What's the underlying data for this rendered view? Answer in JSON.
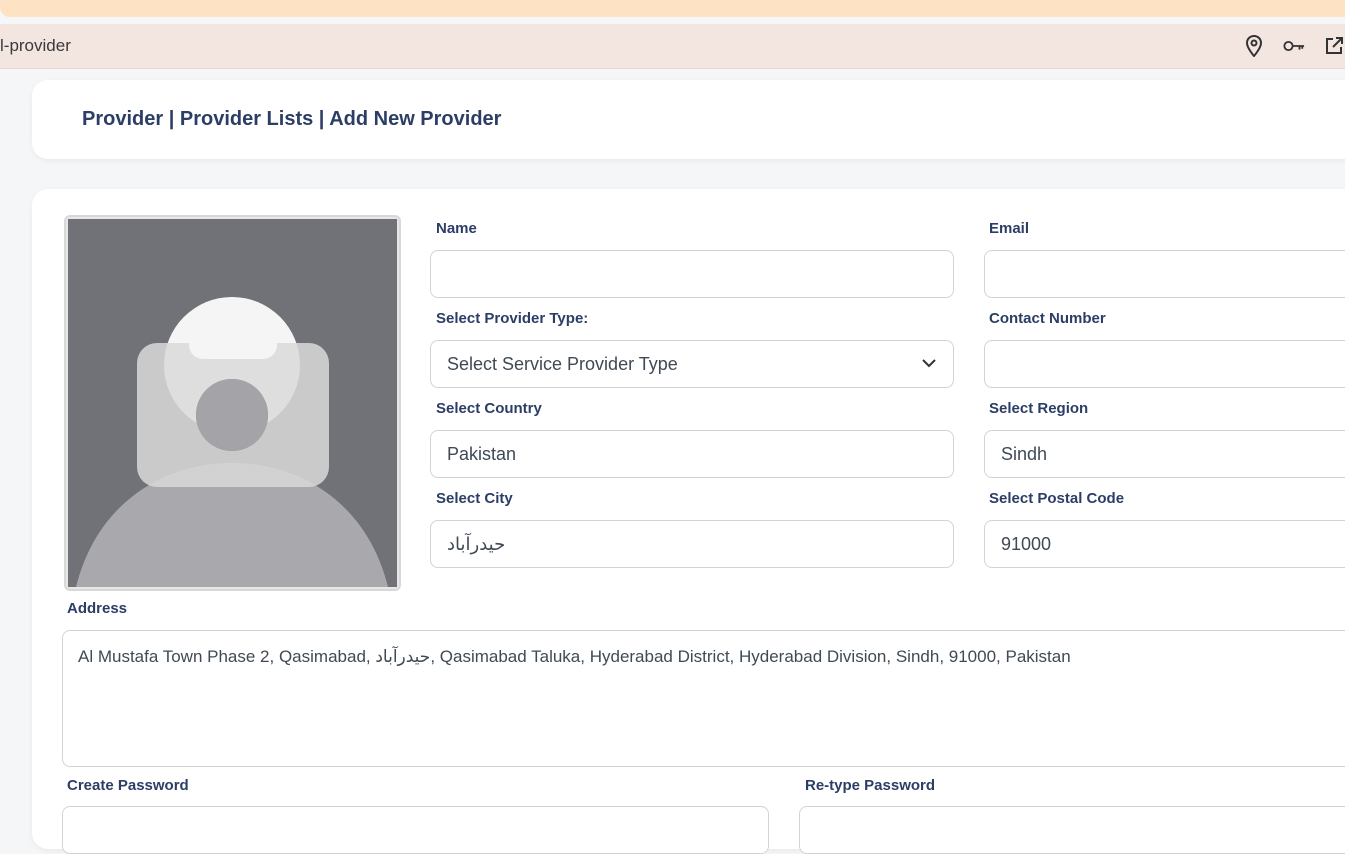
{
  "browser": {
    "url_fragment": "l-provider"
  },
  "breadcrumb": "Provider | Provider Lists | Add New Provider",
  "form": {
    "name": {
      "label": "Name",
      "value": ""
    },
    "email": {
      "label": "Email",
      "value": ""
    },
    "provider_type": {
      "label": "Select Provider Type:",
      "value": "Select Service Provider Type"
    },
    "contact_number": {
      "label": "Contact Number",
      "value": ""
    },
    "country": {
      "label": "Select Country",
      "value": "Pakistan"
    },
    "region": {
      "label": "Select Region",
      "value": "Sindh"
    },
    "city": {
      "label": "Select City",
      "value": "حیدرآباد"
    },
    "postal_code": {
      "label": "Select Postal Code",
      "value": "91000"
    },
    "address": {
      "label": "Address",
      "value": "Al Mustafa Town Phase 2, Qasimabad, حیدرآباد, Qasimabad Taluka, Hyderabad District, Hyderabad Division, Sindh, 91000, Pakistan"
    },
    "create_password": {
      "label": "Create Password"
    },
    "retype_password": {
      "label": "Re-type Password"
    }
  },
  "icons": [
    "location-pin-icon",
    "key-icon",
    "open-external-icon",
    "chevron-down-icon",
    "avatar-placeholder-icon"
  ]
}
